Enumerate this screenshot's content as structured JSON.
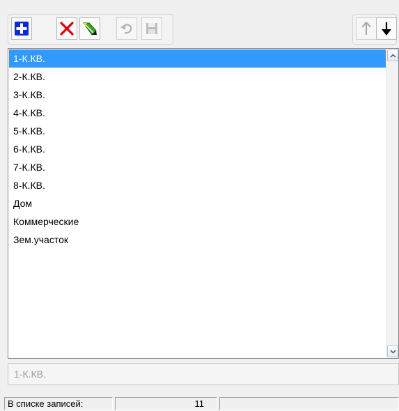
{
  "toolbar": {
    "buttons": [
      {
        "id": "add",
        "icon": "add-icon",
        "enabled": true
      },
      {
        "id": "delete",
        "icon": "delete-icon",
        "enabled": true
      },
      {
        "id": "edit",
        "icon": "edit-icon",
        "enabled": true
      },
      {
        "id": "undo",
        "icon": "undo-icon",
        "enabled": false
      },
      {
        "id": "save",
        "icon": "save-icon",
        "enabled": false
      },
      {
        "id": "move_up",
        "icon": "arrow-up-icon",
        "enabled": false
      },
      {
        "id": "move_down",
        "icon": "arrow-down-icon",
        "enabled": true
      }
    ]
  },
  "list": {
    "selected_index": 0,
    "items": [
      "1-К.КВ.",
      "2-К.КВ.",
      "3-К.КВ.",
      "4-К.КВ.",
      "5-К.КВ.",
      "6-К.КВ.",
      "7-К.КВ.",
      "8-К.КВ.",
      "Дом",
      "Коммерческие",
      "Зем.участок"
    ]
  },
  "value_field": {
    "value": "1-К.КВ."
  },
  "status": {
    "label": "В списке записей:",
    "count": "11",
    "extra": ""
  },
  "colors": {
    "selection": "#3399ff",
    "add_icon": "#0a2bd6",
    "delete_icon": "#e00000",
    "edit_icon": "#3aa81c"
  }
}
